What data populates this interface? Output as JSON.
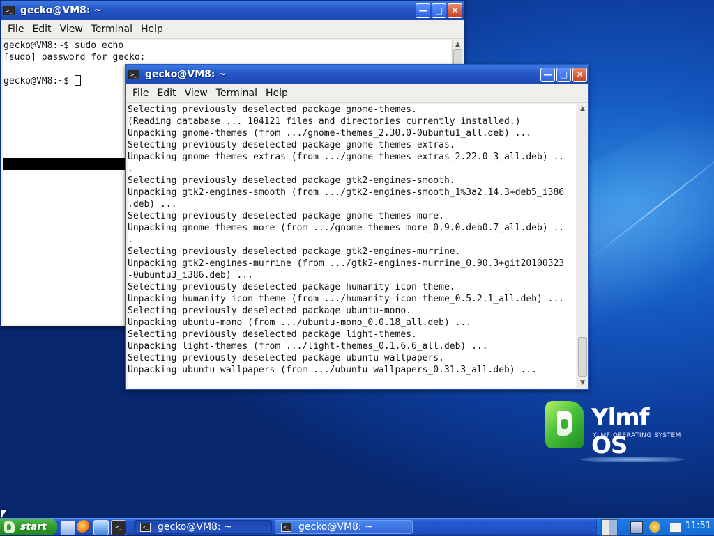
{
  "desktop": {
    "logo_name": "Ylmf OS",
    "logo_sub": "YLMF OPERATING SYSTEM"
  },
  "window_back": {
    "title": "gecko@VM8: ~",
    "menu": [
      "File",
      "Edit",
      "View",
      "Terminal",
      "Help"
    ],
    "lines": [
      "gecko@VM8:~$ sudo echo",
      "[sudo] password for gecko:",
      "",
      "gecko@VM8:~$ "
    ]
  },
  "window_front": {
    "title": "gecko@VM8: ~",
    "menu": [
      "File",
      "Edit",
      "View",
      "Terminal",
      "Help"
    ],
    "lines": [
      "Selecting previously deselected package gnome-themes.",
      "(Reading database ... 104121 files and directories currently installed.)",
      "Unpacking gnome-themes (from .../gnome-themes_2.30.0-0ubuntu1_all.deb) ...",
      "Selecting previously deselected package gnome-themes-extras.",
      "Unpacking gnome-themes-extras (from .../gnome-themes-extras_2.22.0-3_all.deb) ..",
      ".",
      "Selecting previously deselected package gtk2-engines-smooth.",
      "Unpacking gtk2-engines-smooth (from .../gtk2-engines-smooth_1%3a2.14.3+deb5_i386",
      ".deb) ...",
      "Selecting previously deselected package gnome-themes-more.",
      "Unpacking gnome-themes-more (from .../gnome-themes-more_0.9.0.deb0.7_all.deb) ..",
      ".",
      "Selecting previously deselected package gtk2-engines-murrine.",
      "Unpacking gtk2-engines-murrine (from .../gtk2-engines-murrine_0.90.3+git20100323",
      "-0ubuntu3_i386.deb) ...",
      "Selecting previously deselected package humanity-icon-theme.",
      "Unpacking humanity-icon-theme (from .../humanity-icon-theme_0.5.2.1_all.deb) ...",
      "Selecting previously deselected package ubuntu-mono.",
      "Unpacking ubuntu-mono (from .../ubuntu-mono_0.0.18_all.deb) ...",
      "Selecting previously deselected package light-themes.",
      "Unpacking light-themes (from .../light-themes_0.1.6.6_all.deb) ...",
      "Selecting previously deselected package ubuntu-wallpapers.",
      "Unpacking ubuntu-wallpapers (from .../ubuntu-wallpapers_0.31.3_all.deb) ..."
    ]
  },
  "taskbar": {
    "start_label": "start",
    "tasks": [
      {
        "label": "gecko@VM8: ~",
        "active": true
      },
      {
        "label": "gecko@VM8: ~",
        "active": false
      }
    ],
    "clock": "11:51"
  },
  "colors": {
    "titlebar": "#2457c8",
    "start_green": "#2f9a2a",
    "desktop_blue": "#1458c0"
  }
}
